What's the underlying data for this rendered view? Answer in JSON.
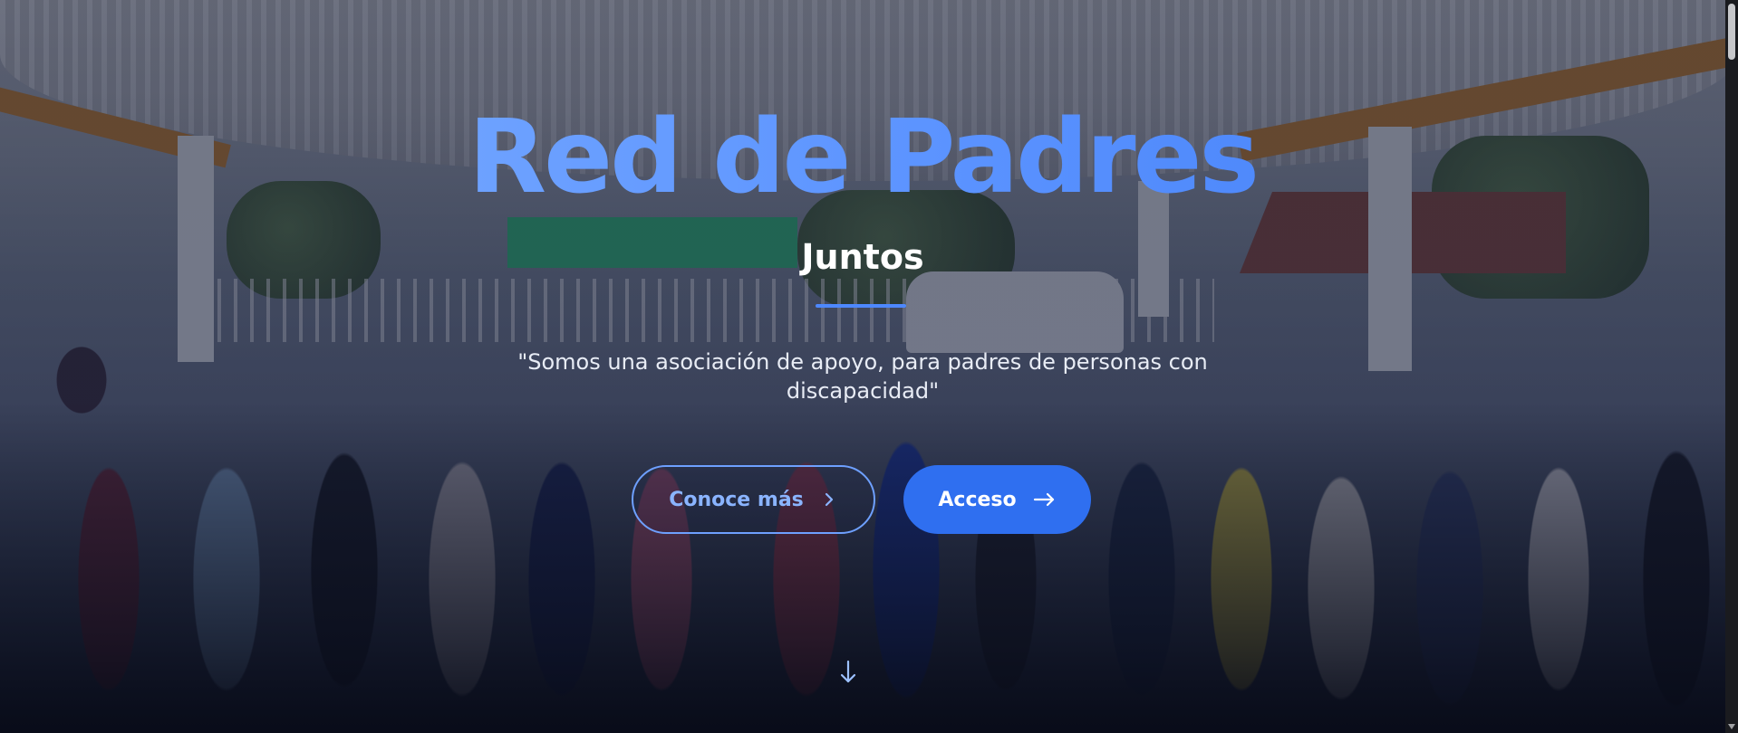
{
  "hero": {
    "title": "Red de Padres",
    "subtitle": "Juntos",
    "tagline": "\"Somos una asociación de apoyo, para padres de personas con discapacidad\""
  },
  "buttons": {
    "learn_more": {
      "label": "Conoce más",
      "icon": "chevron-right-icon"
    },
    "access": {
      "label": "Acceso",
      "icon": "arrow-right-icon"
    }
  },
  "scroll_indicator": {
    "icon": "arrow-down-icon"
  },
  "colors": {
    "accent": "#3d7bf5",
    "title_gradient_start": "#7fb0ff",
    "button_solid": "#2f6ff0",
    "button_outline": "#6ea0ff",
    "overlay": "#121830"
  }
}
